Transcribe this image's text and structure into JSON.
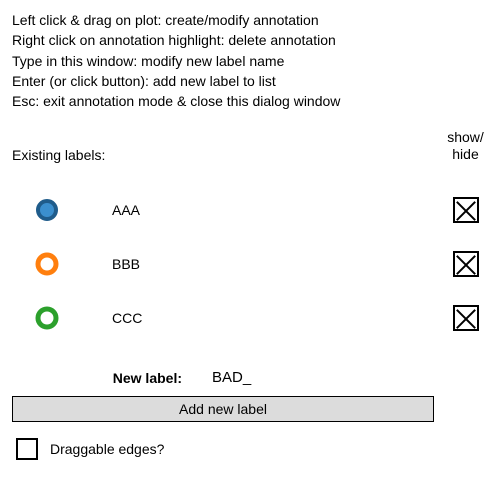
{
  "instructions": {
    "line1": "Left click & drag on plot: create/modify annotation",
    "line2": "Right click on annotation highlight: delete annotation",
    "line3": "Type in this window: modify new label name",
    "line4": "Enter (or click button): add new label to list",
    "line5": "Esc: exit annotation mode & close this dialog window"
  },
  "headers": {
    "existing": "Existing labels:",
    "show": "show/",
    "hide": "hide"
  },
  "labels": [
    {
      "name": "AAA",
      "color": "#3b8fce",
      "stroke": "#1f5c8b",
      "filled": true
    },
    {
      "name": "BBB",
      "color": "#ff7f0e",
      "stroke": "#ff7f0e",
      "filled": false
    },
    {
      "name": "CCC",
      "color": "#2ca02c",
      "stroke": "#2ca02c",
      "filled": false
    }
  ],
  "newlabel": {
    "key": "New label:",
    "value": "BAD_"
  },
  "buttons": {
    "add": "Add new label"
  },
  "draggable": {
    "label": "Draggable edges?",
    "checked": false
  }
}
